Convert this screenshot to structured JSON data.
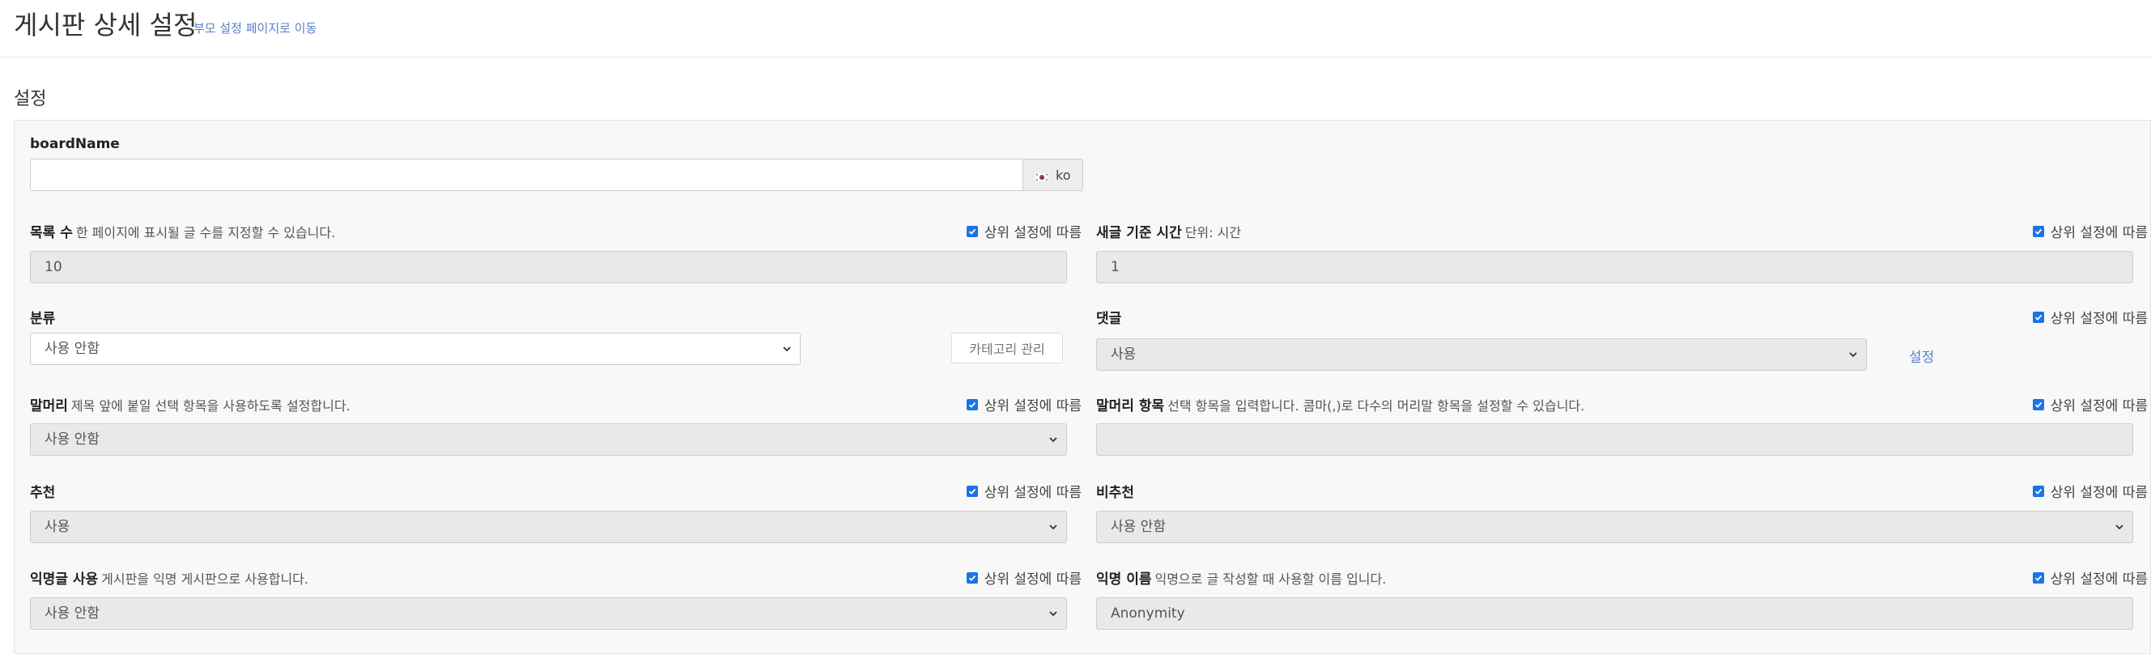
{
  "header": {
    "title": "게시판 상세 설정",
    "parent_link": "부모 설정 페이지로 이동"
  },
  "section": {
    "title": "설정"
  },
  "inherit_label": "상위 설정에 따름",
  "board_name": {
    "label": "boardName",
    "value": "",
    "lang": "ko",
    "flag_icon": "korea-flag-icon"
  },
  "list_count": {
    "label": "목록 수",
    "desc": "한 페이지에 표시될 글 수를 지정할 수 있습니다.",
    "value": "10",
    "inherit": true
  },
  "new_post_time": {
    "label": "새글 기준 시간",
    "desc": "단위: 시간",
    "value": "1",
    "inherit": true
  },
  "category": {
    "label": "분류",
    "value": "사용 안함",
    "manage_button": "카테고리 관리"
  },
  "comment": {
    "label": "댓글",
    "value": "사용",
    "settings_link": "설정",
    "inherit": true
  },
  "prefix": {
    "label": "말머리",
    "desc": "제목 앞에 붙일 선택 항목을 사용하도록 설정합니다.",
    "value": "사용 안함",
    "inherit": true
  },
  "prefix_items": {
    "label": "말머리 항목",
    "desc": "선택 항목을 입력합니다. 콤마(,)로 다수의 머리말 항목을 설정할 수 있습니다.",
    "value": "",
    "inherit": true
  },
  "recommend": {
    "label": "추천",
    "value": "사용",
    "inherit": true
  },
  "not_recommend": {
    "label": "비추천",
    "value": "사용 안함",
    "inherit": true
  },
  "anonymous": {
    "label": "익명글 사용",
    "desc": "게시판을 익명 게시판으로 사용합니다.",
    "value": "사용 안함",
    "inherit": true
  },
  "anonymous_name": {
    "label": "익명 이름",
    "desc": "익명으로 글 작성할 때 사용할 이름 입니다.",
    "value": "Anonymity",
    "inherit": true
  },
  "colors": {
    "accent": "#1a73e8",
    "link": "#5b80c8",
    "panel_bg": "#f8f8f8",
    "disabled_bg": "#e9e9e9"
  }
}
